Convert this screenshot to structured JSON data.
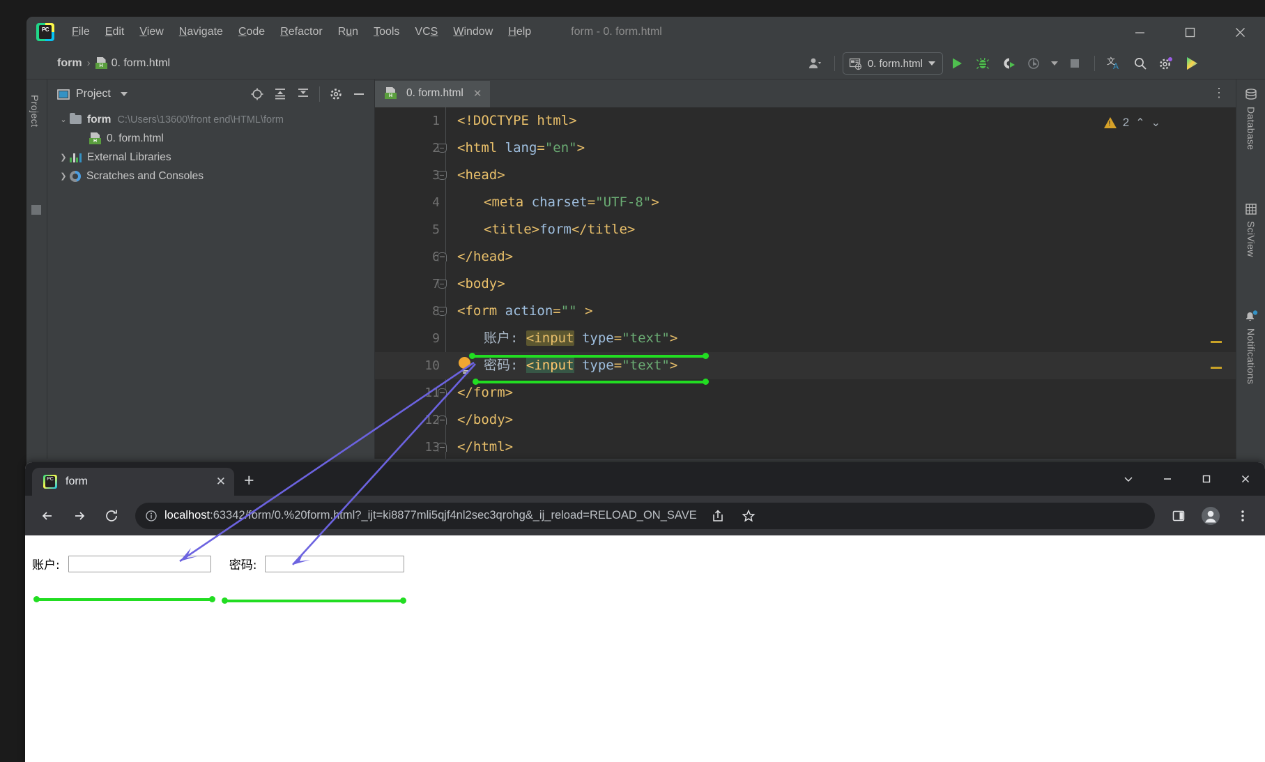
{
  "ide": {
    "window_title": "form - 0. form.html",
    "menu": [
      {
        "label": "File",
        "mnemonic": "F"
      },
      {
        "label": "Edit",
        "mnemonic": "E"
      },
      {
        "label": "View",
        "mnemonic": "V"
      },
      {
        "label": "Navigate",
        "mnemonic": "N"
      },
      {
        "label": "Code",
        "mnemonic": "C"
      },
      {
        "label": "Refactor",
        "mnemonic": "R"
      },
      {
        "label": "Run",
        "mnemonic": "u"
      },
      {
        "label": "Tools",
        "mnemonic": "T"
      },
      {
        "label": "VCS",
        "mnemonic": "S"
      },
      {
        "label": "Window",
        "mnemonic": "W"
      },
      {
        "label": "Help",
        "mnemonic": "H"
      }
    ],
    "window_controls": {
      "minimize": "—",
      "maximize": "□",
      "close": "✕"
    },
    "breadcrumb": {
      "project": "form",
      "separator": "›",
      "file": "0. form.html"
    },
    "toolbar": {
      "run_config": "0. form.html",
      "run_label": "Run",
      "debug_label": "Debug",
      "coverage_label": "Run with Coverage",
      "profile_label": "Profile",
      "stop_label": "Stop",
      "translate_label": "Translate",
      "search_label": "Search Everywhere",
      "settings_label": "Settings",
      "avatar_label": "Account"
    },
    "project_panel": {
      "title": "Project",
      "tree": [
        {
          "label": "form",
          "path": "C:\\Users\\13600\\front end\\HTML\\form",
          "icon": "folder-icon",
          "expanded": true,
          "bold": true,
          "indent": 0
        },
        {
          "label": "0. form.html",
          "path": "",
          "icon": "html-file-icon",
          "expanded": null,
          "bold": false,
          "indent": 1
        },
        {
          "label": "External Libraries",
          "path": "",
          "icon": "libraries-icon",
          "expanded": false,
          "bold": false,
          "indent": 0
        },
        {
          "label": "Scratches and Consoles",
          "path": "",
          "icon": "scratches-icon",
          "expanded": false,
          "bold": false,
          "indent": 0
        }
      ]
    },
    "left_strip": {
      "label": "Project"
    },
    "editor": {
      "tab": "0. form.html",
      "warning_count": "2",
      "lines": [
        {
          "n": "1",
          "fold": "none",
          "indent": 0,
          "tokens": [
            {
              "t": "<!DOCTYPE html>",
              "c": "tk-doc"
            }
          ]
        },
        {
          "n": "2",
          "fold": "start",
          "indent": 0,
          "tokens": [
            {
              "t": "<html ",
              "c": "tk-tag"
            },
            {
              "t": "lang",
              "c": "tk-attr"
            },
            {
              "t": "=",
              "c": "tk-tag"
            },
            {
              "t": "\"en\"",
              "c": "tk-str"
            },
            {
              "t": ">",
              "c": "tk-tag"
            }
          ]
        },
        {
          "n": "3",
          "fold": "start",
          "indent": 0,
          "tokens": [
            {
              "t": "<head>",
              "c": "tk-tag"
            }
          ]
        },
        {
          "n": "4",
          "fold": "none",
          "indent": 1,
          "tokens": [
            {
              "t": "<meta ",
              "c": "tk-tag"
            },
            {
              "t": "charset",
              "c": "tk-attr"
            },
            {
              "t": "=",
              "c": "tk-tag"
            },
            {
              "t": "\"UTF-8\"",
              "c": "tk-str"
            },
            {
              "t": ">",
              "c": "tk-tag"
            }
          ]
        },
        {
          "n": "5",
          "fold": "none",
          "indent": 1,
          "tokens": [
            {
              "t": "<title>",
              "c": "tk-tag"
            },
            {
              "t": "form",
              "c": "tk-attr"
            },
            {
              "t": "</title>",
              "c": "tk-tag"
            }
          ]
        },
        {
          "n": "6",
          "fold": "end",
          "indent": 0,
          "tokens": [
            {
              "t": "</head>",
              "c": "tk-tag"
            }
          ]
        },
        {
          "n": "7",
          "fold": "start",
          "indent": 0,
          "tokens": [
            {
              "t": "<body>",
              "c": "tk-tag"
            }
          ]
        },
        {
          "n": "8",
          "fold": "start",
          "indent": 0,
          "tokens": [
            {
              "t": "<form ",
              "c": "tk-tag"
            },
            {
              "t": "action",
              "c": "tk-attr"
            },
            {
              "t": "=",
              "c": "tk-tag"
            },
            {
              "t": "\"\"",
              "c": "tk-str"
            },
            {
              "t": " >",
              "c": "tk-tag"
            }
          ]
        },
        {
          "n": "9",
          "fold": "none",
          "indent": 1,
          "tokens": [
            {
              "t": "账户: ",
              "c": "tk-txt"
            },
            {
              "t": "<input",
              "c": "tk-tag hl-ident"
            },
            {
              "t": " ",
              "c": "tk-tag"
            },
            {
              "t": "type",
              "c": "tk-attr"
            },
            {
              "t": "=",
              "c": "tk-tag"
            },
            {
              "t": "\"text\"",
              "c": "tk-str"
            },
            {
              "t": ">",
              "c": "tk-tag"
            }
          ]
        },
        {
          "n": "10",
          "fold": "none",
          "indent": 1,
          "highlight": true,
          "bulb": true,
          "tokens": [
            {
              "t": "密码: ",
              "c": "tk-txt"
            },
            {
              "t": "<input",
              "c": "tk-yellow hl-green"
            },
            {
              "t": " ",
              "c": "tk-tag"
            },
            {
              "t": "type",
              "c": "tk-attr"
            },
            {
              "t": "=",
              "c": "tk-tag"
            },
            {
              "t": "\"text\"",
              "c": "tk-str"
            },
            {
              "t": ">",
              "c": "tk-tag"
            }
          ]
        },
        {
          "n": "11",
          "fold": "end",
          "indent": 0,
          "tokens": [
            {
              "t": "</form>",
              "c": "tk-tag"
            }
          ]
        },
        {
          "n": "12",
          "fold": "end",
          "indent": 0,
          "tokens": [
            {
              "t": "</body>",
              "c": "tk-tag"
            }
          ]
        },
        {
          "n": "13",
          "fold": "end",
          "indent": 0,
          "tokens": [
            {
              "t": "</html>",
              "c": "tk-tag"
            }
          ]
        }
      ]
    },
    "right_strip": [
      {
        "label": "Database",
        "icon": "database-icon"
      },
      {
        "label": "SciView",
        "icon": "grid-icon"
      },
      {
        "label": "Notifications",
        "icon": "bell-icon",
        "badge": true
      }
    ]
  },
  "browser": {
    "tab": {
      "title": "form",
      "close": "✕"
    },
    "new_tab": "+",
    "window_controls": {
      "collapse": "⌄",
      "minimize": "—",
      "maximize": "□",
      "close": "✕"
    },
    "nav": {
      "back": "←",
      "forward": "→",
      "reload": "⟳"
    },
    "address": {
      "host": "localhost",
      "rest": ":63342/form/0.%20form.html?_ijt=ki8877mli5qjf4nl2sec3qrohg&_ij_reload=RELOAD_ON_SAVE",
      "info_icon": "info-circle-icon"
    },
    "toolbar_right": [
      "share-icon",
      "bookmark-star-icon",
      "side-panel-icon",
      "profile-avatar-icon",
      "three-dot-menu-icon"
    ],
    "page": {
      "account_label": "账户:",
      "password_label": "密码:",
      "account_value": "",
      "password_value": ""
    }
  },
  "annotations": {
    "accent_green": "#22dd22",
    "arrow_color": "#6c63e0",
    "note": "two green underline markers connecting code inputs to rendered inputs"
  }
}
